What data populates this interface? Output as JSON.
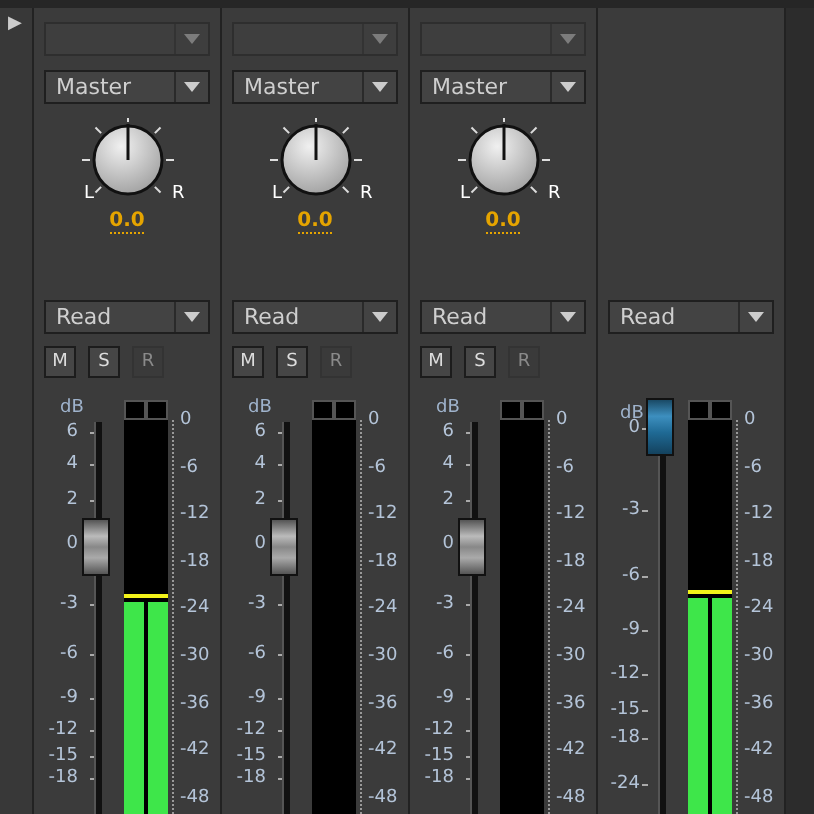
{
  "collapse_toggle": "▶",
  "channels": [
    {
      "kind": "track",
      "input": {
        "disabled": true
      },
      "output": "Master",
      "pan": "0.0",
      "pan_labels": [
        "L",
        "R"
      ],
      "automation": "Read",
      "buttons": [
        {
          "label": "M",
          "disabled": false
        },
        {
          "label": "S",
          "disabled": false
        },
        {
          "label": "R",
          "disabled": true
        }
      ],
      "fader_unit": "dB",
      "fader_scale": [
        "6",
        "4",
        "2",
        "0",
        "-3",
        "-6",
        "-9",
        "-12",
        "-15",
        "-18"
      ],
      "fader": {
        "level": 0.68,
        "selected": false
      },
      "meter": {
        "level": 0.54
      },
      "meter_scale": [
        "0",
        "-6",
        "-12",
        "-18",
        "-24",
        "-30",
        "-36",
        "-42",
        "-48"
      ]
    },
    {
      "kind": "track",
      "input": {
        "disabled": true
      },
      "output": "Master",
      "pan": "0.0",
      "pan_labels": [
        "L",
        "R"
      ],
      "automation": "Read",
      "buttons": [
        {
          "label": "M",
          "disabled": false
        },
        {
          "label": "S",
          "disabled": false
        },
        {
          "label": "R",
          "disabled": true
        }
      ],
      "fader_unit": "dB",
      "fader_scale": [
        "6",
        "4",
        "2",
        "0",
        "-3",
        "-6",
        "-9",
        "-12",
        "-15",
        "-18"
      ],
      "fader": {
        "level": 0.68,
        "selected": false
      },
      "meter": {
        "level": 0
      },
      "meter_scale": [
        "0",
        "-6",
        "-12",
        "-18",
        "-24",
        "-30",
        "-36",
        "-42",
        "-48"
      ]
    },
    {
      "kind": "track",
      "input": {
        "disabled": true
      },
      "output": "Master",
      "pan": "0.0",
      "pan_labels": [
        "L",
        "R"
      ],
      "automation": "Read",
      "buttons": [
        {
          "label": "M",
          "disabled": false
        },
        {
          "label": "S",
          "disabled": false
        },
        {
          "label": "R",
          "disabled": true
        }
      ],
      "fader_unit": "dB",
      "fader_scale": [
        "6",
        "4",
        "2",
        "0",
        "-3",
        "-6",
        "-9",
        "-12",
        "-15",
        "-18"
      ],
      "fader": {
        "level": 0.68,
        "selected": false
      },
      "meter": {
        "level": 0
      },
      "meter_scale": [
        "0",
        "-6",
        "-12",
        "-18",
        "-24",
        "-30",
        "-36",
        "-42",
        "-48"
      ]
    },
    {
      "kind": "master",
      "automation": "Read",
      "fader_unit": "dB",
      "fader_scale": [
        "0",
        "-3",
        "-6",
        "-9",
        "-12",
        "-15",
        "-18",
        "-24"
      ],
      "fader": {
        "level": 0.985,
        "selected": true
      },
      "meter": {
        "level": 0.55
      },
      "meter_scale": [
        "0",
        "-6",
        "-12",
        "-18",
        "-24",
        "-30",
        "-36",
        "-42",
        "-48"
      ]
    }
  ]
}
